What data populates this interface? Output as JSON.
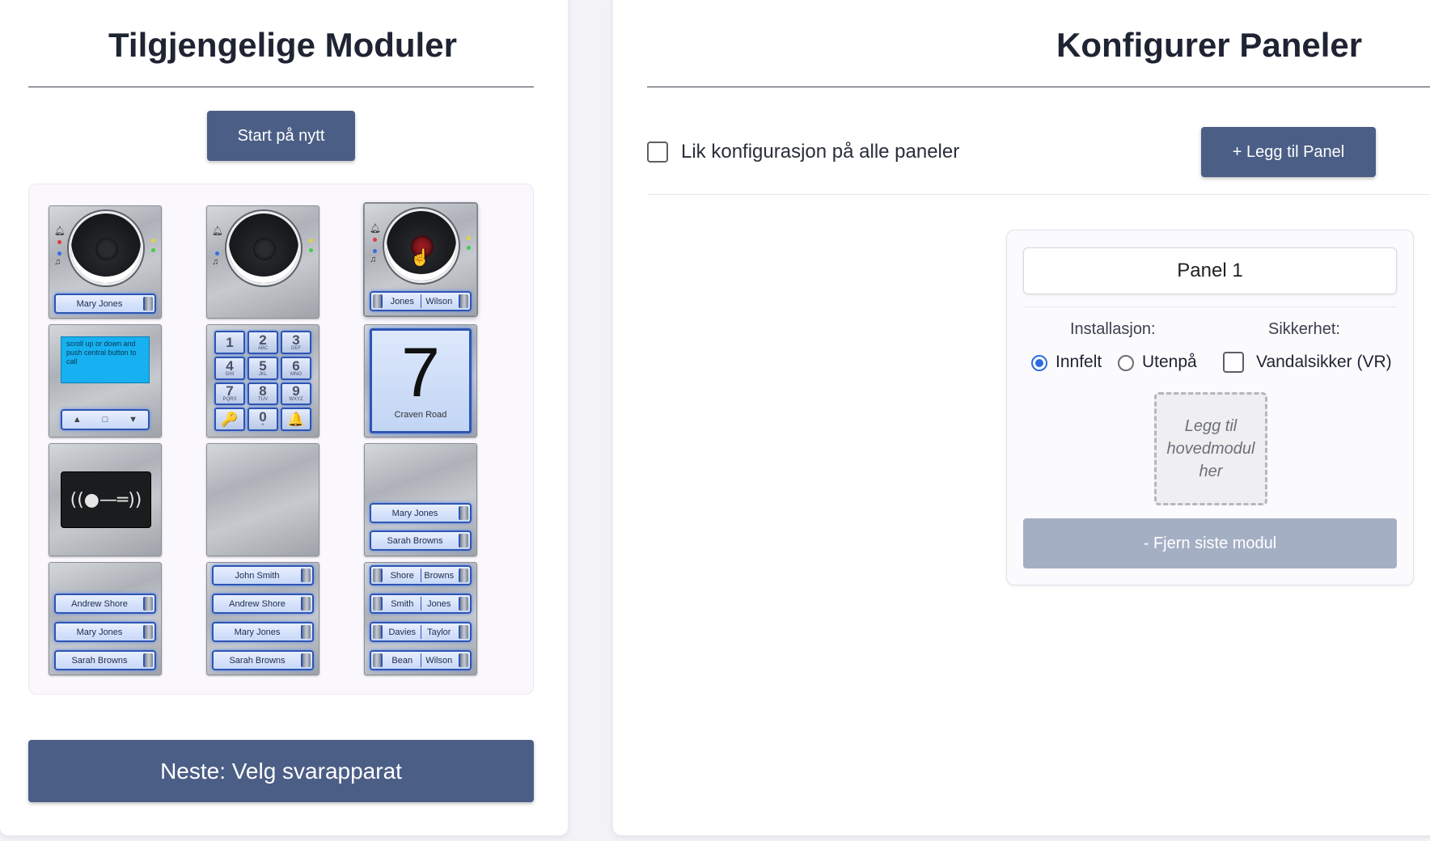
{
  "left": {
    "title": "Tilgjengelige Moduler",
    "restart_label": "Start på nytt",
    "next_label": "Neste: Velg svarapparat",
    "modules": {
      "cam1_name": "Mary Jones",
      "cam3_left": "Jones",
      "cam3_right": "Wilson",
      "display_text": "scroll up or down and push central button to call",
      "nav_up": "▲",
      "nav_mid": "□",
      "nav_down": "▼",
      "keys": [
        {
          "n": "1",
          "s": ""
        },
        {
          "n": "2",
          "s": "ABC"
        },
        {
          "n": "3",
          "s": "DEF"
        },
        {
          "n": "4",
          "s": "GHI"
        },
        {
          "n": "5",
          "s": "JKL"
        },
        {
          "n": "6",
          "s": "MNO"
        },
        {
          "n": "7",
          "s": "PQRS"
        },
        {
          "n": "8",
          "s": "TUV"
        },
        {
          "n": "9",
          "s": "WXYZ"
        },
        {
          "n": "🔑",
          "s": ""
        },
        {
          "n": "0",
          "s": "+"
        },
        {
          "n": "🔔",
          "s": ""
        }
      ],
      "house_number": "7",
      "street": "Craven Road",
      "rfid_symbol": "((●—═))",
      "two_names_a": "Mary Jones",
      "two_names_b": "Sarah Browns",
      "three_names": [
        "Andrew Shore",
        "Mary Jones",
        "Sarah Browns"
      ],
      "four_names": [
        "John Smith",
        "Andrew Shore",
        "Mary Jones",
        "Sarah Browns"
      ],
      "double_rows": [
        [
          "Shore",
          "Browns"
        ],
        [
          "Smith",
          "Jones"
        ],
        [
          "Davies",
          "Taylor"
        ],
        [
          "Bean",
          "Wilson"
        ]
      ]
    }
  },
  "right": {
    "title": "Konfigurer Paneler",
    "same_config_label": "Lik konfigurasjon på alle paneler",
    "add_panel_label": "+ Legg til Panel",
    "panel": {
      "name": "Panel 1",
      "installation_label": "Installasjon:",
      "security_label": "Sikkerhet:",
      "option_flush": "Innfelt",
      "option_surface": "Utenpå",
      "option_vandal": "Vandalsikker (VR)",
      "selected_installation": "Innfelt",
      "drop_text": "Legg til hovedmodul her",
      "remove_label": "- Fjern siste modul"
    }
  },
  "colors": {
    "primary_button": "#4b5e86",
    "disabled_button": "#a5afc4",
    "nameplate_border": "#2d55b3",
    "radio_accent": "#2b6de0"
  }
}
